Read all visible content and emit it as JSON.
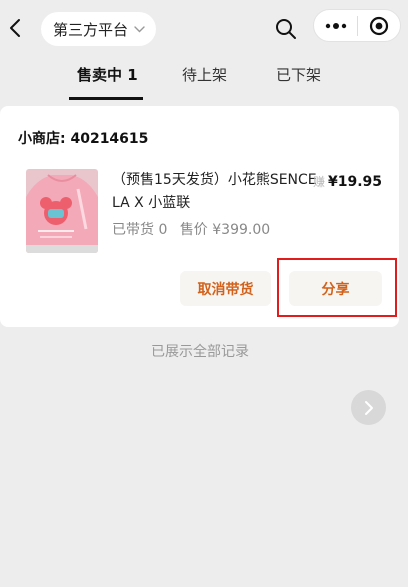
{
  "nav": {
    "platform_label": "第三方平台"
  },
  "tabs": [
    {
      "label": "售卖中 1",
      "active": true
    },
    {
      "label": "待上架",
      "active": false
    },
    {
      "label": "已下架",
      "active": false
    }
  ],
  "shop": {
    "name": "小商店: 40214615"
  },
  "product": {
    "title": "（预售15天发货）小花熊SENCE LA X 小蓝联",
    "earn_label": "赚",
    "commission": "¥19.95",
    "sold_count": "已带货 0",
    "sale_price": "售价 ¥399.00"
  },
  "actions": {
    "cancel_label": "取消带货",
    "share_label": "分享"
  },
  "footer": {
    "end_note": "已展示全部记录"
  },
  "icons": {
    "back": "chevron-left-icon",
    "dropdown": "chevron-down-icon",
    "search": "search-icon",
    "more": "more-dots-icon",
    "close": "target-circle-icon",
    "next": "chevron-right-icon"
  },
  "colors": {
    "accent": "#d2621b",
    "highlight": "#e21b1b",
    "background": "#ededed"
  }
}
